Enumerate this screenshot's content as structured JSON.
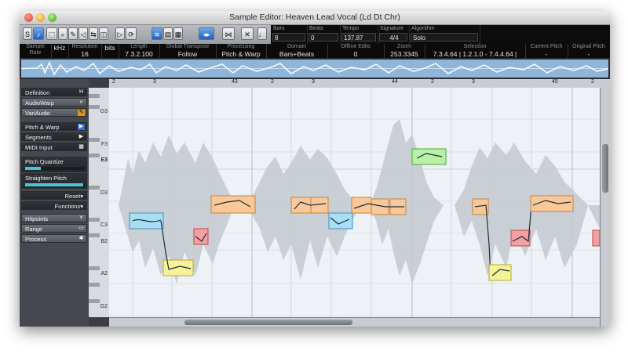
{
  "window": {
    "title": "Sample Editor: Heaven Lead Vocal (Ld Dt Chr)"
  },
  "toolbar": {
    "fields": [
      {
        "label": "Bars",
        "value": "8"
      },
      {
        "label": "Beats",
        "value": "0"
      },
      {
        "label": "Tempo",
        "value": "137.87"
      },
      {
        "label": "Signature",
        "value": "4/4"
      },
      {
        "label": "Algorithm",
        "value": "Solo"
      }
    ]
  },
  "infobar": {
    "fields": [
      {
        "label": "Sample Rate",
        "value": "44100"
      },
      {
        "label": "",
        "value": "kHz"
      },
      {
        "label": "Resolution",
        "value": "16"
      },
      {
        "label": "",
        "value": "bits"
      },
      {
        "label": "Length",
        "value": "7.3.2.100"
      },
      {
        "label": "Global Transpose",
        "value": "Follow"
      },
      {
        "label": "Processing",
        "value": "Pitch & Warp"
      },
      {
        "label": "Domain",
        "value": "Bars+Beats"
      },
      {
        "label": "Offline Edits",
        "value": "0"
      },
      {
        "label": "Zoom",
        "value": "253.3345"
      },
      {
        "label": "Selection",
        "value": "7.3.4.64 | 1.2.1.0 - 7.4.4.64 |"
      },
      {
        "label": "Current Pitch",
        "value": "-"
      },
      {
        "label": "Original Pitch",
        "value": "-"
      }
    ]
  },
  "left_panel": {
    "items": [
      {
        "label": "Definition",
        "icon": "H"
      },
      {
        "label": "AudioWarp",
        "icon": "»"
      },
      {
        "label": "VariAudio",
        "icon": "✎"
      },
      {
        "label": "Pitch & Warp",
        "icon": "▶"
      },
      {
        "label": "Segments",
        "icon": "▶"
      },
      {
        "label": "MIDI Input",
        "icon": "▦"
      },
      {
        "label": "Pitch Quantize",
        "icon": ""
      },
      {
        "label": "Straighten Pitch",
        "icon": ""
      },
      {
        "label": "Reset",
        "icon": "▾"
      },
      {
        "label": "Functions",
        "icon": "▾"
      },
      {
        "label": "Hitpoints",
        "icon": "Y"
      },
      {
        "label": "Range",
        "icon": "▭"
      },
      {
        "label": "Process",
        "icon": "✱"
      }
    ]
  },
  "ruler": {
    "labels": [
      "2",
      "3",
      "43",
      "2",
      "3",
      "44",
      "2",
      "3",
      "45",
      "2"
    ]
  },
  "keys": {
    "labels": [
      "G3",
      "F3",
      "E3",
      "D3",
      "C3",
      "B2",
      "A2",
      "G2"
    ]
  },
  "colors": {
    "accent": "#2f6fd6",
    "plot_bg": "#eef1f5",
    "segment_blue": "#a9def3",
    "segment_orange": "#f8c89a",
    "segment_red": "#f2a0a0",
    "segment_yellow": "#f6f29a",
    "segment_green": "#b8f0a5"
  }
}
